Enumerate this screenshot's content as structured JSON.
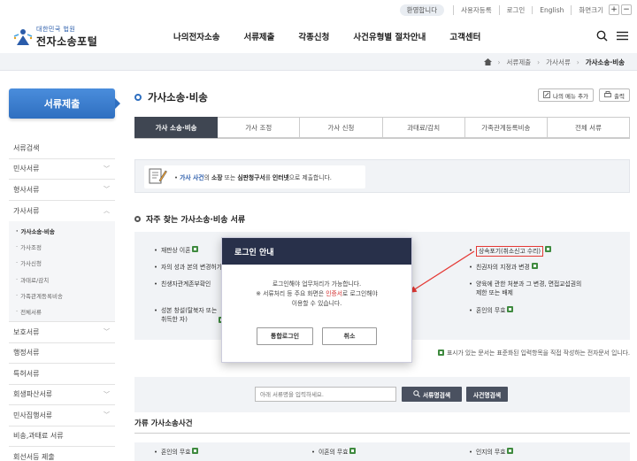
{
  "util": {
    "welcome": "환영합니다",
    "links": [
      "사용자등록",
      "로그인",
      "English"
    ],
    "zoom_label": "화면크기",
    "zoom_in": "+",
    "zoom_out": "−"
  },
  "logo": {
    "sub": "대한민국 법원",
    "main": "전자소송포털"
  },
  "gnb": [
    "나의전자소송",
    "서류제출",
    "각종신청",
    "사건유형별 절차안내",
    "고객센터"
  ],
  "breadcrumb": [
    "서류제출",
    "가사서류",
    "가사소송·비송"
  ],
  "sidebar": {
    "title": "서류제출",
    "items": [
      {
        "label": "서류검색",
        "chev": ""
      },
      {
        "label": "민사서류",
        "chev": "﹀"
      },
      {
        "label": "형사서류",
        "chev": "﹀"
      },
      {
        "label": "가사서류",
        "chev": "︿"
      }
    ],
    "sub_items": [
      "가사소송·비송",
      "가사조정",
      "가사신청",
      "과태료/감치",
      "가족관계등록비송",
      "전체서류"
    ],
    "items_after": [
      {
        "label": "보호서류",
        "chev": "﹀"
      },
      {
        "label": "행정서류",
        "chev": ""
      },
      {
        "label": "특허서류",
        "chev": ""
      },
      {
        "label": "회생파산서류",
        "chev": "﹀"
      },
      {
        "label": "민사집행서류",
        "chev": "﹀"
      },
      {
        "label": "비송,과태료 서류",
        "chev": ""
      },
      {
        "label": "회선서등 제출",
        "chev": ""
      }
    ]
  },
  "page": {
    "title": "가사소송·비송",
    "my_menu_btn": "나의 메뉴 추가",
    "print_btn": "출력"
  },
  "tabs": [
    "가사 소송·비송",
    "가사 조정",
    "가사 신청",
    "과태료/감치",
    "가족관계등록비송",
    "전체 서류"
  ],
  "notice": {
    "prefix": "가사 사건",
    "t1": "의 ",
    "b1": "소장",
    "t2": " 또는 ",
    "b2": "심판청구서",
    "t3": "를 ",
    "b3": "인터넷",
    "t4": "으로 제출합니다."
  },
  "faq": {
    "title": "자주 찾는 가사소송·비송 서류",
    "col1": [
      "재판상 이혼",
      "자의 성과 본의 변경허가",
      "친생자관계존부확인",
      "성본 창설(탈북자 또는",
      "취득한 자)"
    ],
    "col3": [
      "상속포기(취소신고 수리)",
      "친권자의 지정과 변경",
      "양육에 관한 처분과 그 변경, 면접교섭권의",
      "제한 또는 배제",
      "혼인의 무효"
    ],
    "note": "표시가 있는 문서는 표준화된 입력항목을 직접 작성하는 전자문서 입니다."
  },
  "search": {
    "placeholder": "아래 서류명을 입력하세요.",
    "btn1": "서류명검색",
    "btn2": "사건명검색"
  },
  "sub_section": {
    "title": "가류 가사소송사건",
    "items": [
      "혼인의 무효",
      "이혼의 무효",
      "인지의 무효"
    ]
  },
  "modal": {
    "title": "로그인 안내",
    "line1": "로그인해야 업무처리가 가능합니다.",
    "line2a": "※ 서류처리 등 주요 화면은 ",
    "line2b": "인증서",
    "line2c": "로 로그인해야",
    "line3": "이용할 수 있습니다.",
    "btn_login": "통합로그인",
    "btn_cancel": "취소"
  },
  "colors": {
    "accent": "#2f6fc0",
    "tab_active": "#3f4652",
    "modal_head": "#28304a",
    "highlight": "#e53935"
  }
}
